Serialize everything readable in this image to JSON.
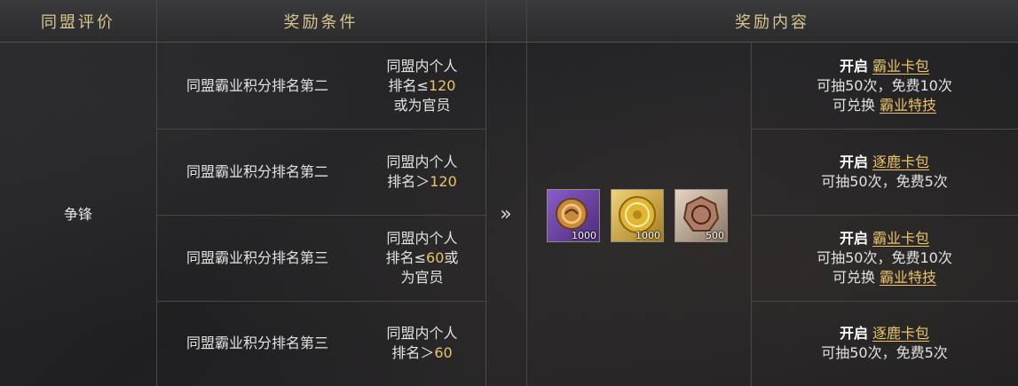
{
  "headers": {
    "evaluation": "同盟评价",
    "conditions": "奖励条件",
    "rewards": "奖励内容"
  },
  "evaluation_value": "争锋",
  "rows": [
    {
      "rank": "同盟霸业积分排名第二",
      "cond_prefix": "同盟内个人",
      "cond_line2_a": "排名≤",
      "cond_num": "120",
      "cond_line2_b": "",
      "cond_line3": "或为官员"
    },
    {
      "rank": "同盟霸业积分排名第二",
      "cond_prefix": "同盟内个人",
      "cond_line2_a": "排名＞",
      "cond_num": "120",
      "cond_line2_b": "",
      "cond_line3": ""
    },
    {
      "rank": "同盟霸业积分排名第三",
      "cond_prefix": "同盟内个人",
      "cond_line2_a": "排名≤",
      "cond_num": "60",
      "cond_line2_b": "或",
      "cond_line3": "为官员"
    },
    {
      "rank": "同盟霸业积分排名第三",
      "cond_prefix": "同盟内个人",
      "cond_line2_a": "排名＞",
      "cond_num": "60",
      "cond_line2_b": "",
      "cond_line3": ""
    }
  ],
  "arrow": "»",
  "items": [
    {
      "icon": "purple-token-icon",
      "count": "1000"
    },
    {
      "icon": "gold-coin-icon",
      "count": "1000"
    },
    {
      "icon": "bronze-medal-icon",
      "count": "500"
    }
  ],
  "rewards": [
    {
      "open": "开启",
      "pack": "霸业卡包",
      "draws": "可抽50次，免费10次",
      "exchange": "可兑换",
      "skill": "霸业特技"
    },
    {
      "open": "开启",
      "pack": "逐鹿卡包",
      "draws": "可抽50次，免费5次",
      "exchange": "",
      "skill": ""
    },
    {
      "open": "开启",
      "pack": "霸业卡包",
      "draws": "可抽50次，免费10次",
      "exchange": "可兑换",
      "skill": "霸业特技"
    },
    {
      "open": "开启",
      "pack": "逐鹿卡包",
      "draws": "可抽50次，免费5次",
      "exchange": "",
      "skill": ""
    }
  ],
  "colors": {
    "gold": "#e9c46a",
    "header_text": "#d8c690"
  }
}
